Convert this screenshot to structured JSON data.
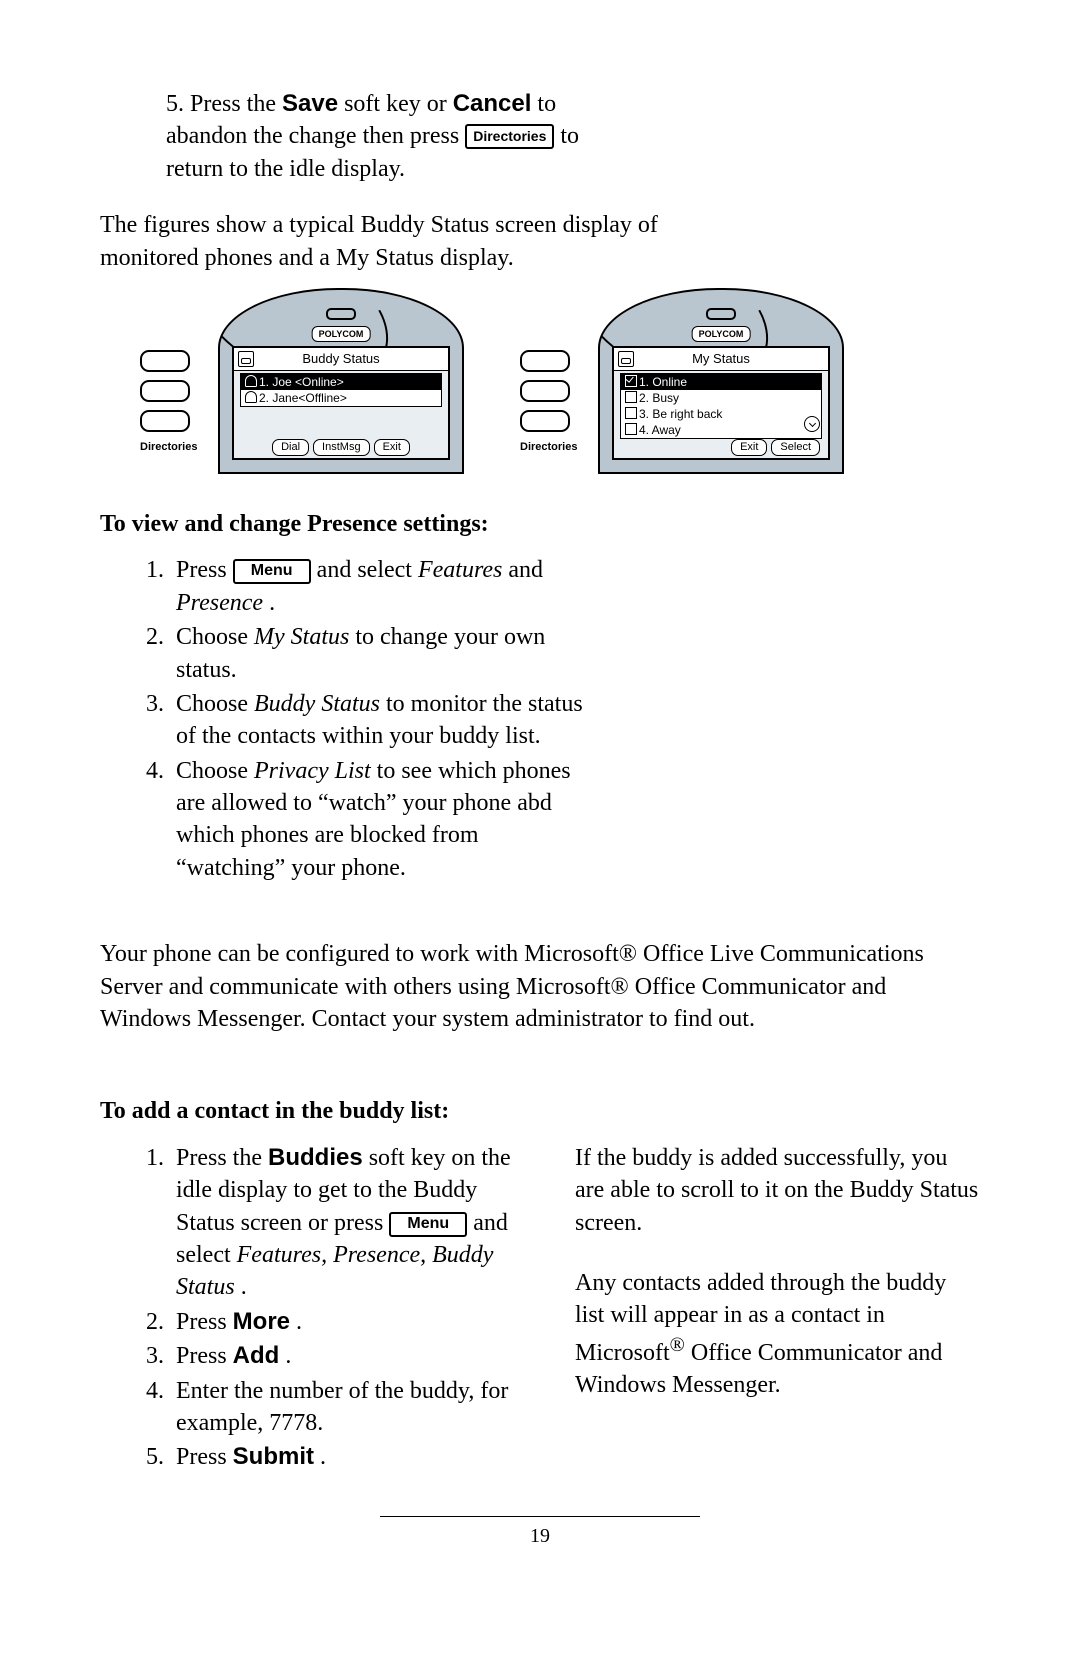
{
  "page_number": "19",
  "keys": {
    "directories": "Directories",
    "menu": "Menu"
  },
  "bold_terms": {
    "save": "Save",
    "cancel": "Cancel",
    "buddies": "Buddies",
    "more": "More",
    "add": "Add",
    "submit": "Submit"
  },
  "step5": {
    "prefix": "5.  Press the ",
    "p1": " soft key or ",
    "p2": " to abandon the change then press ",
    "p3": " to return to the idle display."
  },
  "caption": "The figures show a typical Buddy Status screen dis­play of monitored phones and a My Status display.",
  "fig1": {
    "brand": "POLYCOM",
    "title": "Buddy Status",
    "rows": [
      "1.   Joe <Online>",
      "2.   Jane<Offline>"
    ],
    "softkeys": [
      "Dial",
      "InstMsg",
      "Exit"
    ],
    "side_label": "Directories"
  },
  "fig2": {
    "brand": "POLYCOM",
    "title": "My Status",
    "rows": [
      "1.   Online",
      "2.   Busy",
      "3.   Be right back",
      "4.   Away"
    ],
    "softkeys": [
      "Exit",
      "Select"
    ],
    "side_label": "Directories"
  },
  "heading1": "To view and change Presence settings:",
  "presence_instructions": {
    "i1a": "Press ",
    "i1b": " and select ",
    "i1c": "Features",
    "i1d": " and ",
    "i1e": "Presence",
    "i1f": ".",
    "i2a": "Choose ",
    "i2b": "My Status",
    "i2c": " to change your own status.",
    "i3a": "Choose ",
    "i3b": "Buddy Status",
    "i3c": " to monitor the status of the contacts within your buddy list.",
    "i4a": "Choose ",
    "i4b": "Privacy List",
    "i4c": " to see which phones are allowed to “watch” your phone abd which phones are blocked  from “watching” your phone."
  },
  "ms_para": "Your phone can be configured to work with Microsoft® Office Live Communications Server and communicate with others using Microsoft® Office Communicator and Windows Messenger. Contact your system administrator to find out.",
  "heading2": "To add a contact in the buddy list:",
  "add_instructions": {
    "i1a": "Press the ",
    "i1b": " soft key on the idle display to get to the Buddy Status screen or press ",
    "i1c": " and select ",
    "i1d": "Features, Presence, Buddy Status",
    "i1e": ".",
    "i2a": "Press ",
    "i2b": ".",
    "i3a": "Press ",
    "i3b": ".",
    "i4": "Enter the number of the buddy, for example, 7778.",
    "i5a": "Press ",
    "i5b": "."
  },
  "right_p1": "If the buddy is added successfully, you are able to scroll to it on the Buddy Status screen.",
  "right_p2a": "Any contacts added through the buddy list will appear in as a contact in Microsoft",
  "right_p2sup": "®",
  "right_p2b": " Office Communicator and Windows Messenger."
}
